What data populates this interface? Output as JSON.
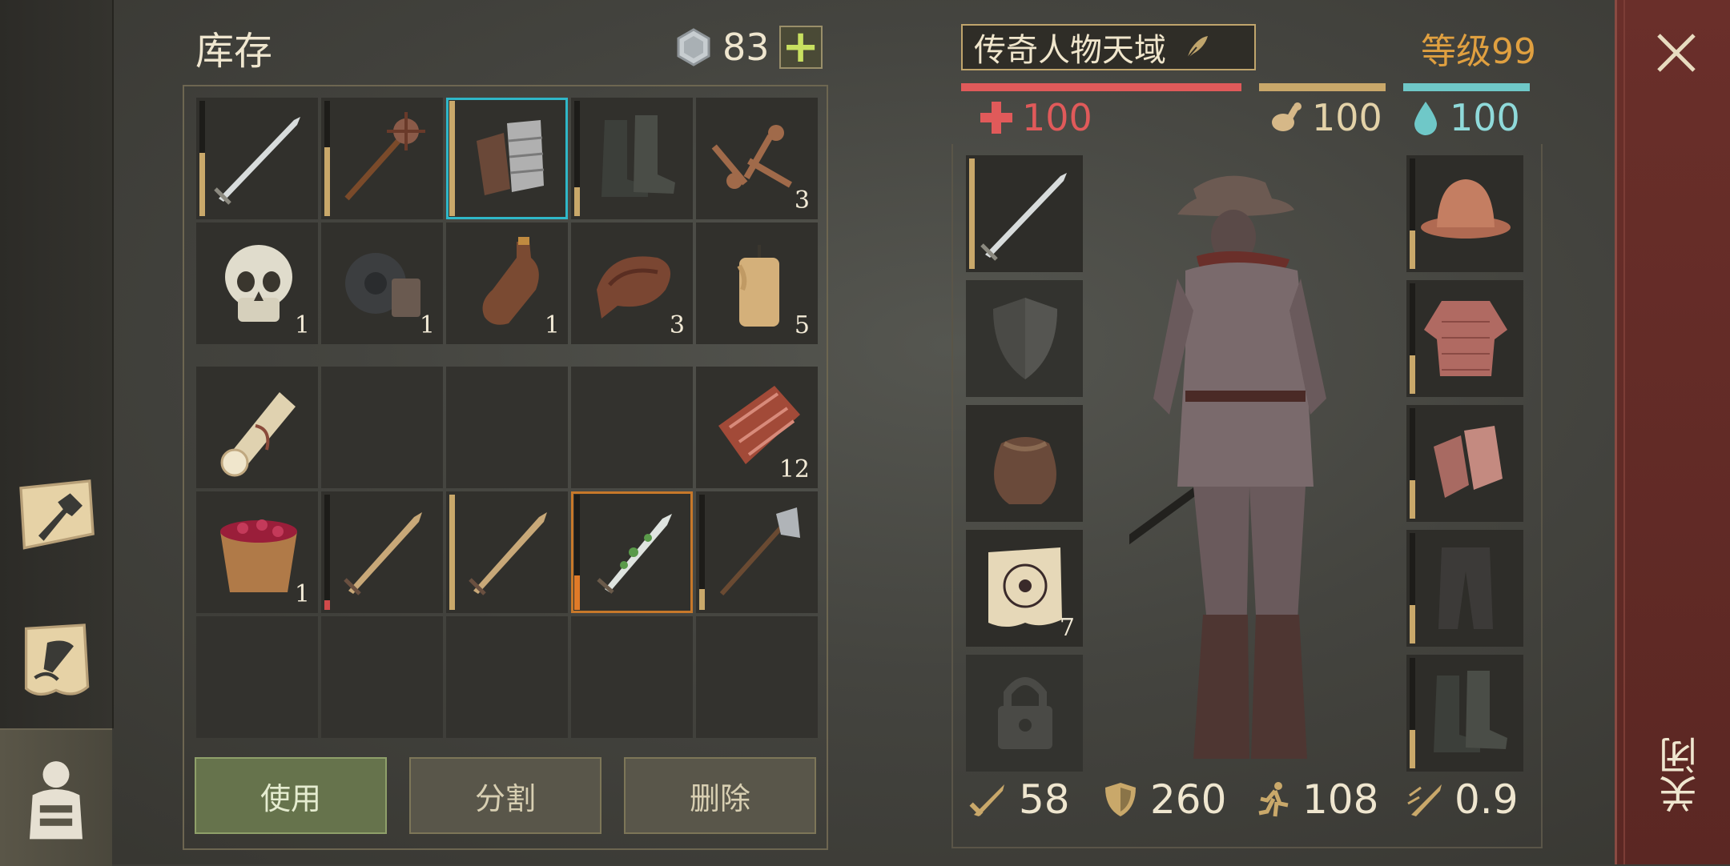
{
  "inventory": {
    "title": "库存",
    "currency": "83",
    "plus_label": "+",
    "top_items": [
      {
        "icon": "sword-icon",
        "count": "",
        "durability": 0.55
      },
      {
        "icon": "mace-icon",
        "count": "",
        "durability": 0.6
      },
      {
        "icon": "gauntlets-icon",
        "count": "",
        "durability": 1.0
      },
      {
        "icon": "boots-icon",
        "count": "",
        "durability": 0.25
      },
      {
        "icon": "nails-icon",
        "count": "3",
        "durability": null
      },
      {
        "icon": "skull-icon",
        "count": "1",
        "durability": null
      },
      {
        "icon": "gear-icon",
        "count": "1",
        "durability": null
      },
      {
        "icon": "bottle-icon",
        "count": "1",
        "durability": null
      },
      {
        "icon": "leather-icon",
        "count": "3",
        "durability": null
      },
      {
        "icon": "candle-icon",
        "count": "5",
        "durability": null
      }
    ],
    "bottom_items": [
      {
        "icon": "scroll-icon",
        "count": "",
        "durability": null
      },
      {
        "icon": "",
        "count": "",
        "durability": null
      },
      {
        "icon": "",
        "count": "",
        "durability": null
      },
      {
        "icon": "",
        "count": "",
        "durability": null
      },
      {
        "icon": "raw-meat-icon",
        "count": "12",
        "durability": null
      },
      {
        "icon": "berry-bucket-icon",
        "count": "1",
        "durability": null
      },
      {
        "icon": "short-sword-icon",
        "count": "",
        "durability": 0.08
      },
      {
        "icon": "short-sword-icon",
        "count": "",
        "durability": 1.0
      },
      {
        "icon": "poisoned-dagger-icon",
        "count": "",
        "durability": 0.3
      },
      {
        "icon": "halberd-icon",
        "count": "",
        "durability": 0.18
      }
    ],
    "buttons": {
      "use": "使用",
      "split": "分割",
      "delete": "删除"
    }
  },
  "character": {
    "name": "传奇人物天域",
    "level": "等级99",
    "health": "100",
    "hunger": "100",
    "thirst": "100",
    "left_slots": [
      {
        "icon": "sword-icon",
        "count": "",
        "durability": 1.0
      },
      {
        "icon": "shield-icon",
        "count": "",
        "durability": null
      },
      {
        "icon": "pouch-icon",
        "count": "",
        "durability": null
      },
      {
        "icon": "map-scroll-icon",
        "count": "7",
        "durability": null
      },
      {
        "icon": "lock-icon",
        "count": "",
        "durability": null
      }
    ],
    "right_slots": [
      {
        "icon": "helmet-icon",
        "durability": 0.35
      },
      {
        "icon": "chainmail-icon",
        "durability": 0.35
      },
      {
        "icon": "gloves-icon",
        "durability": 0.35
      },
      {
        "icon": "leggings-icon",
        "durability": 0.35
      },
      {
        "icon": "boots-icon",
        "durability": 0.35
      }
    ],
    "stats": {
      "attack": "58",
      "defense": "260",
      "speed": "108",
      "attack_speed": "0.9"
    }
  },
  "close_label": "关闭",
  "colors": {
    "health": "#e05a5a",
    "hunger": "#c9a86a",
    "thirst": "#6fc8c8",
    "level": "#e0a040",
    "selected_cyan": "#2fb7c8",
    "selected_orange": "#c7782a"
  }
}
